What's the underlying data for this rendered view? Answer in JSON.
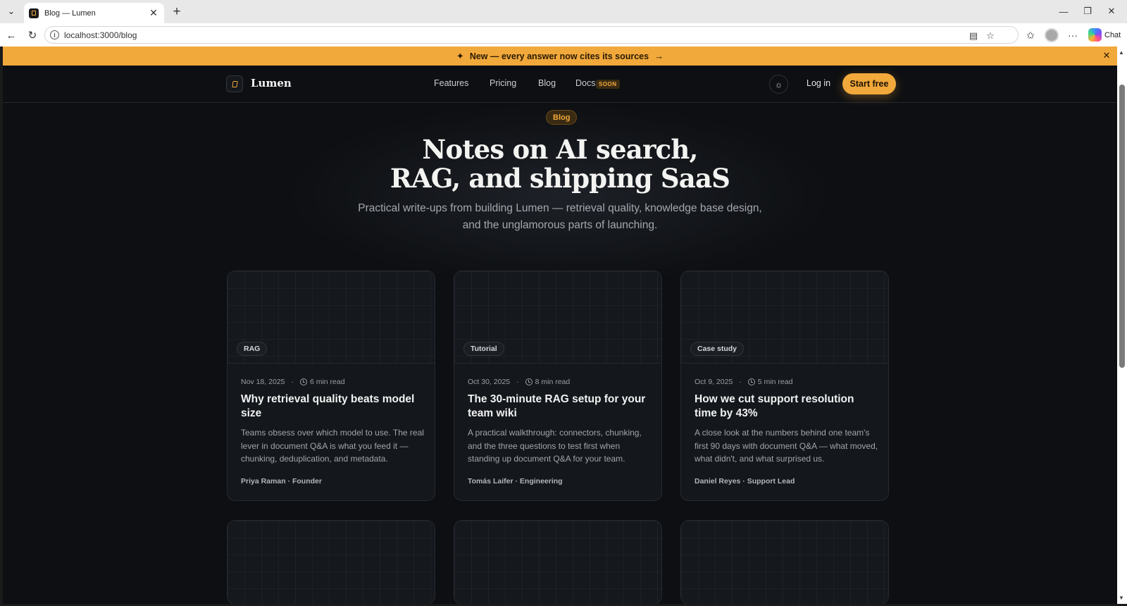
{
  "browser": {
    "tab_title": "Blog — Lumen",
    "url": "localhost:3000/blog",
    "chat_label": "Chat"
  },
  "announcement": {
    "text": "New — every answer now cites its sources"
  },
  "nav": {
    "brand": "Lumen",
    "links": [
      "Features",
      "Pricing",
      "Blog",
      "Docs"
    ],
    "docs_badge": "SOON",
    "login": "Log in",
    "cta": "Start free"
  },
  "hero": {
    "pill": "Blog",
    "title_line1": "Notes on AI search,",
    "title_line2": "RAG, and shipping SaaS",
    "subtitle": "Practical write-ups from building Lumen — retrieval quality, knowledge base design, and the unglamorous parts of launching."
  },
  "posts": [
    {
      "tag": "RAG",
      "date": "Nov 18, 2025",
      "read": "6 min read",
      "title": "Why retrieval quality beats model size",
      "excerpt": "Teams obsess over which model to use. The real lever in document Q&A is what you feed it — chunking, deduplication, and metadata.",
      "author": "Priya Raman · Founder"
    },
    {
      "tag": "Tutorial",
      "date": "Oct 30, 2025",
      "read": "8 min read",
      "title": "The 30-minute RAG setup for your team wiki",
      "excerpt": "A practical walkthrough: connectors, chunking, and the three questions to test first when standing up document Q&A for your team.",
      "author": "Tomás Laifer · Engineering"
    },
    {
      "tag": "Case study",
      "date": "Oct 9, 2025",
      "read": "5 min read",
      "title": "How we cut support resolution time by 43%",
      "excerpt": "A close look at the numbers behind one team's first 90 days with document Q&A — what moved, what didn't, and what surprised us.",
      "author": "Daniel Reyes · Support Lead"
    }
  ],
  "colors": {
    "accent": "#f2a93b",
    "page_bg": "#0d0f12",
    "card_bg": "#14171b"
  }
}
